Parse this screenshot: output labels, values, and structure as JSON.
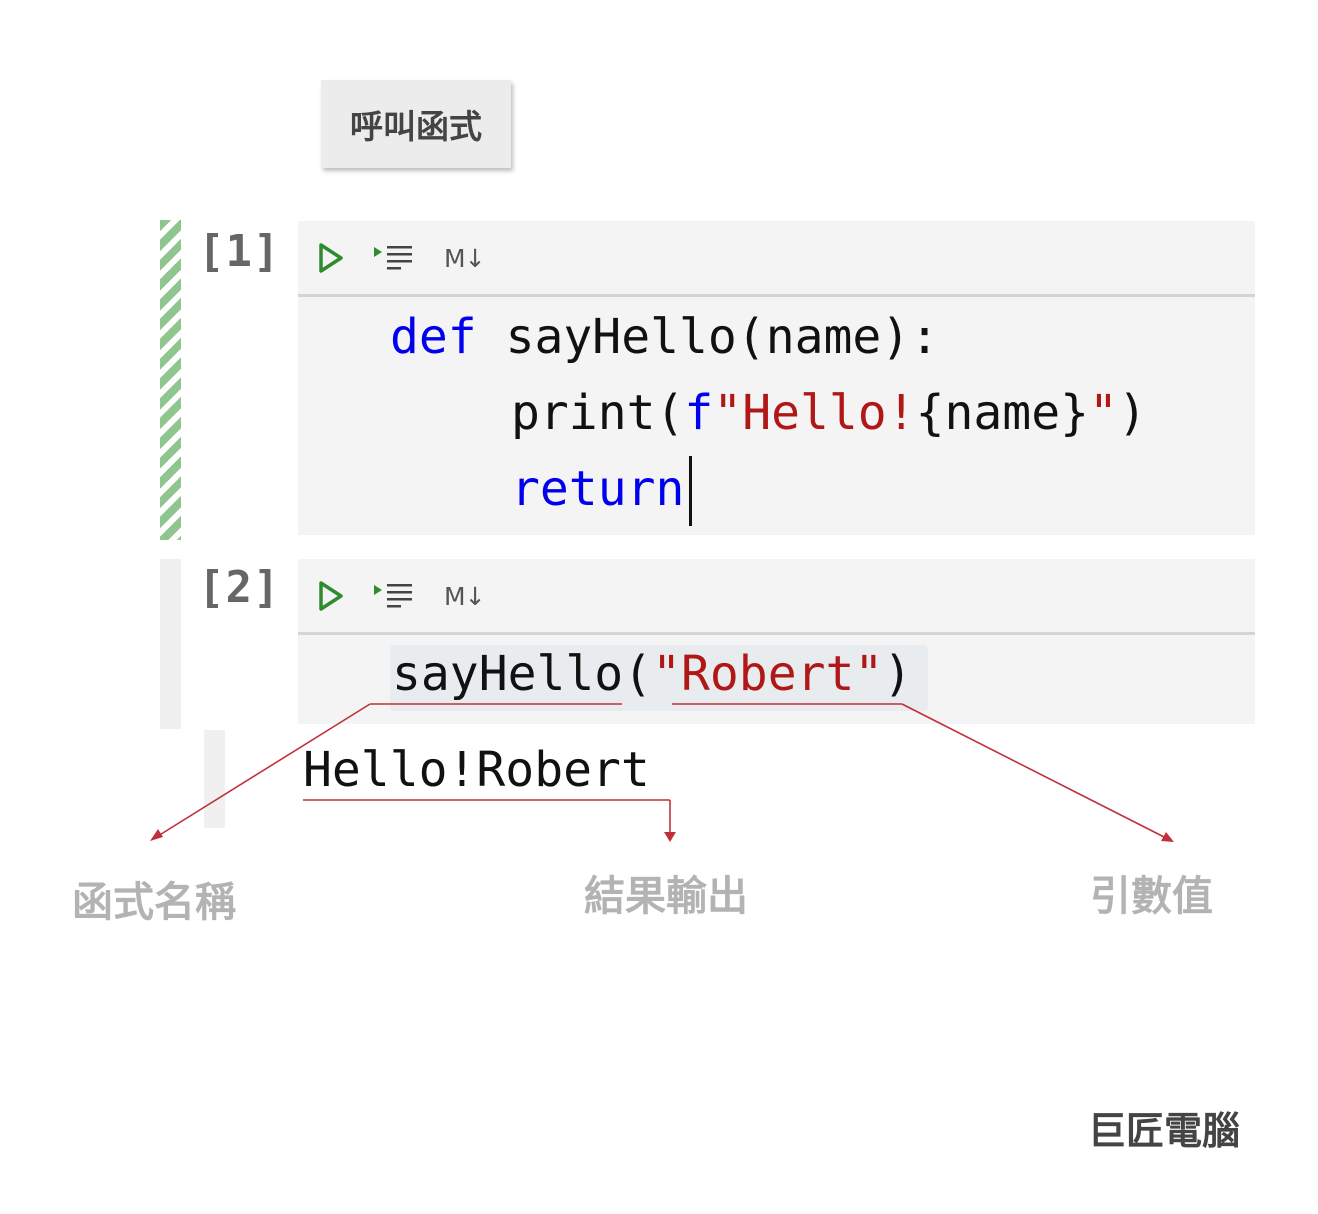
{
  "title_button": "呼叫函式",
  "cells": [
    {
      "prompt": "[1]",
      "toolbar": {
        "run_icon": "run-triangle-icon",
        "run_all_icon": "run-below-icon",
        "markdown": "M↓"
      },
      "code": {
        "line1_kw": "def",
        "line1_rest": " sayHello(name):",
        "line2_a": "print(",
        "line2_f": "f",
        "line2_str": "\"Hello!",
        "line2_mid": "{name}",
        "line2_q": "\"",
        "line2_end": ")",
        "line3_kw": "return"
      }
    },
    {
      "prompt": "[2]",
      "toolbar": {
        "run_icon": "run-triangle-icon",
        "run_all_icon": "run-below-icon",
        "markdown": "M↓"
      },
      "code": {
        "call_name": "sayHello(",
        "call_arg": "\"Robert\"",
        "call_end": ")"
      }
    }
  ],
  "output": "Hello!Robert",
  "annotations": {
    "function_name": "函式名稱",
    "result_output": "結果輸出",
    "argument_value": "引數值"
  },
  "brand": "巨匠電腦",
  "colors": {
    "keyword": "#0000ee",
    "string": "#b01818",
    "annotation_line": "#c0303a",
    "run_green": "#2e8b2e"
  }
}
